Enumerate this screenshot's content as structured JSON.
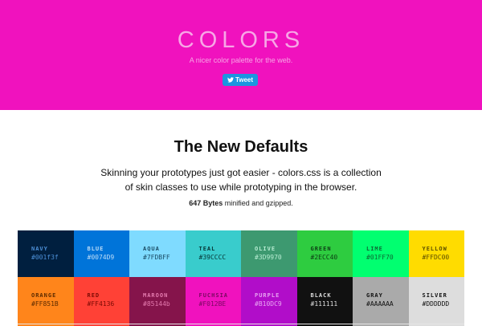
{
  "hero": {
    "title": "COLORS",
    "subtitle": "A nicer color palette for the web.",
    "tweet_label": "Tweet",
    "background": "#F012BE"
  },
  "intro": {
    "heading": "The New Defaults",
    "description": "Skinning your prototypes just got easier - colors.css is a collection of skin classes to use while prototyping in the browser.",
    "size_bold": "647 Bytes",
    "size_rest": " minified and gzipped."
  },
  "swatches": [
    {
      "name": "NAVY",
      "hex": "#001f3f",
      "bg": "#001f3f",
      "fg": "#4c8fd6"
    },
    {
      "name": "BLUE",
      "hex": "#0074D9",
      "bg": "#0074D9",
      "fg": "#bcdcf7"
    },
    {
      "name": "AQUA",
      "hex": "#7FDBFF",
      "bg": "#7FDBFF",
      "fg": "#1b4d66"
    },
    {
      "name": "TEAL",
      "hex": "#39CCCC",
      "bg": "#39CCCC",
      "fg": "#073636"
    },
    {
      "name": "OLIVE",
      "hex": "#3D9970",
      "bg": "#3D9970",
      "fg": "#b7ecd2"
    },
    {
      "name": "GREEN",
      "hex": "#2ECC40",
      "bg": "#2ECC40",
      "fg": "#0d3d14"
    },
    {
      "name": "LIME",
      "hex": "#01FF70",
      "bg": "#01FF70",
      "fg": "#0d6633"
    },
    {
      "name": "YELLOW",
      "hex": "#FFDC00",
      "bg": "#FFDC00",
      "fg": "#5c4f00"
    },
    {
      "name": "ORANGE",
      "hex": "#FF851B",
      "bg": "#FF851B",
      "fg": "#5c2b00"
    },
    {
      "name": "RED",
      "hex": "#FF4136",
      "bg": "#FF4136",
      "fg": "#7a0a04"
    },
    {
      "name": "MAROON",
      "hex": "#85144b",
      "bg": "#85144b",
      "fg": "#e47aae"
    },
    {
      "name": "FUCHSIA",
      "hex": "#F012BE",
      "bg": "#F012BE",
      "fg": "#7a0861"
    },
    {
      "name": "PURPLE",
      "hex": "#B10DC9",
      "bg": "#B10DC9",
      "fg": "#e8a4f2"
    },
    {
      "name": "BLACK",
      "hex": "#111111",
      "bg": "#111111",
      "fg": "#dddddd"
    },
    {
      "name": "GRAY",
      "hex": "#AAAAAA",
      "bg": "#AAAAAA",
      "fg": "#111111"
    },
    {
      "name": "SILVER",
      "hex": "#DDDDDD",
      "bg": "#DDDDDD",
      "fg": "#111111"
    }
  ]
}
